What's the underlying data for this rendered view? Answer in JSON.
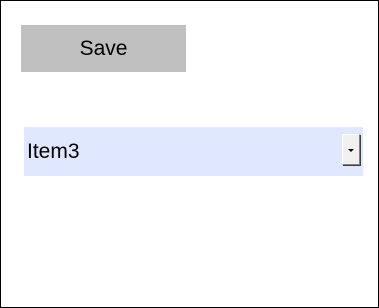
{
  "toolbar": {
    "save_label": "Save"
  },
  "dropdown": {
    "selected_value": "Item3",
    "arrow_icon": "chevron-down-icon"
  },
  "colors": {
    "button_background": "#c0c0c0",
    "dropdown_background": "#e0e8ff",
    "border": "#000000"
  }
}
